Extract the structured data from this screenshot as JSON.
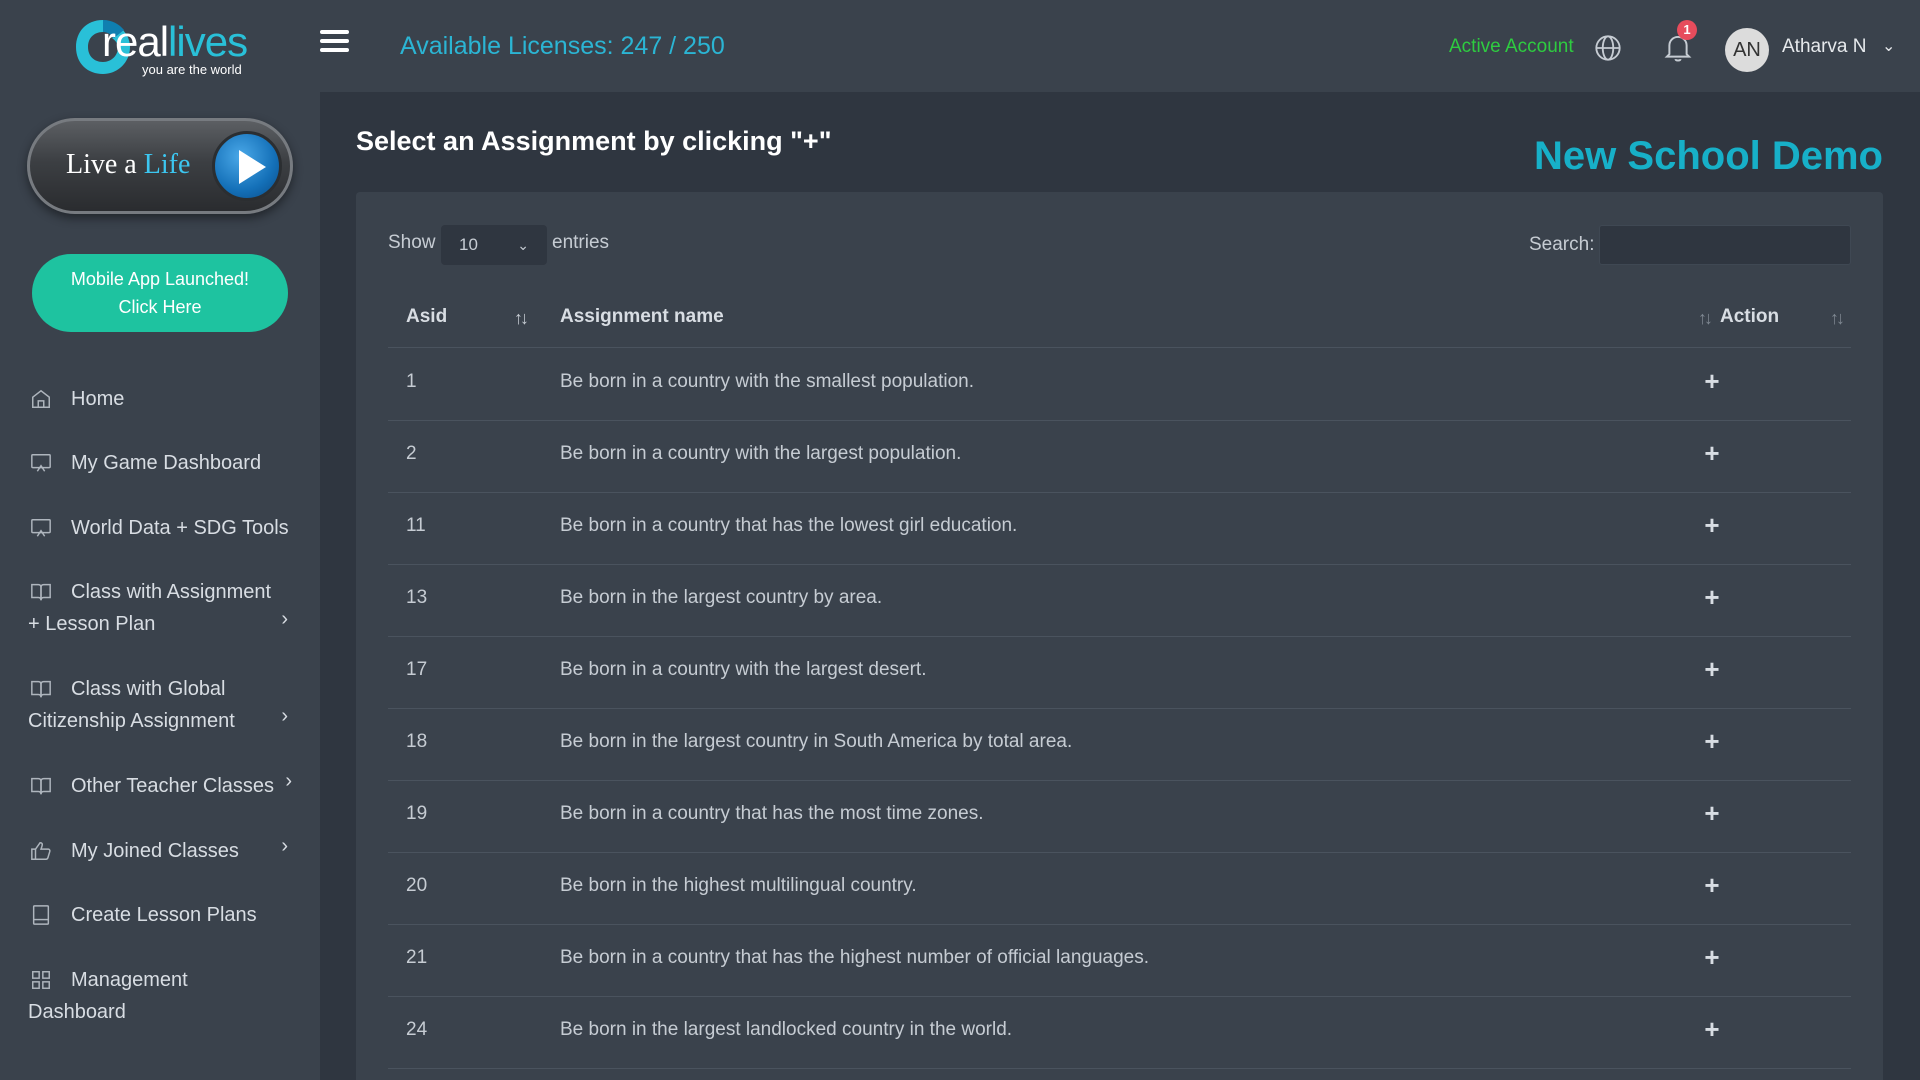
{
  "logo": {
    "word_real": "real",
    "word_lives": "lives",
    "tagline": "you are the world"
  },
  "live_a_life": {
    "prefix": "Live a ",
    "highlight": "Life"
  },
  "mobile_app": {
    "line1": "Mobile App Launched!",
    "line2": "Click Here"
  },
  "sidebar": {
    "items": [
      {
        "label": "Home",
        "icon": "home-icon"
      },
      {
        "label": "My Game Dashboard",
        "icon": "monitor-icon"
      },
      {
        "label": "World Data + SDG Tools",
        "icon": "monitor-icon"
      },
      {
        "label": "Class with Assignment",
        "label2": "+ Lesson Plan",
        "icon": "book-icon",
        "expandable": true
      },
      {
        "label": "Class with Global",
        "label2": "Citizenship Assignment",
        "icon": "book-icon",
        "expandable": true
      },
      {
        "label": "Other Teacher Classes",
        "icon": "book-icon",
        "expandable": true
      },
      {
        "label": "My Joined Classes",
        "icon": "thumbs-up-icon",
        "expandable": true
      },
      {
        "label": "Create Lesson Plans",
        "icon": "notebook-icon"
      },
      {
        "label": "Management",
        "label2": "Dashboard",
        "icon": "grid-icon"
      }
    ]
  },
  "topbar": {
    "licenses": "Available Licenses: 247 / 250",
    "account_status": "Active Account",
    "notification_count": "1",
    "avatar_initials": "AN",
    "user_name": "Atharva N"
  },
  "main": {
    "heading": "Select an Assignment by clicking \"+\"",
    "school_name": "New School Demo"
  },
  "table": {
    "show_label": "Show",
    "page_size": "10",
    "entries_label": "entries",
    "search_label": "Search:",
    "search_value": "",
    "columns": [
      "Asid",
      "Assignment name",
      "Action"
    ],
    "action_symbol": "+",
    "rows": [
      {
        "id": "1",
        "name": "Be born in a country with the smallest population."
      },
      {
        "id": "2",
        "name": "Be born in a country with the largest population."
      },
      {
        "id": "11",
        "name": "Be born in a country that has the lowest girl education."
      },
      {
        "id": "13",
        "name": "Be born in the largest country by area."
      },
      {
        "id": "17",
        "name": "Be born in a country with the largest desert."
      },
      {
        "id": "18",
        "name": "Be born in the largest country in South America by total area."
      },
      {
        "id": "19",
        "name": "Be born in a country that has the most time zones."
      },
      {
        "id": "20",
        "name": "Be born in the highest multilingual country."
      },
      {
        "id": "21",
        "name": "Be born in a country that has the highest number of official languages."
      },
      {
        "id": "24",
        "name": "Be born in the largest landlocked country in the world."
      }
    ]
  },
  "colors": {
    "accent": "#2bb5d4",
    "success": "#2ecc40",
    "mint_button": "#1ec3a0",
    "badge": "#e74c5c"
  }
}
